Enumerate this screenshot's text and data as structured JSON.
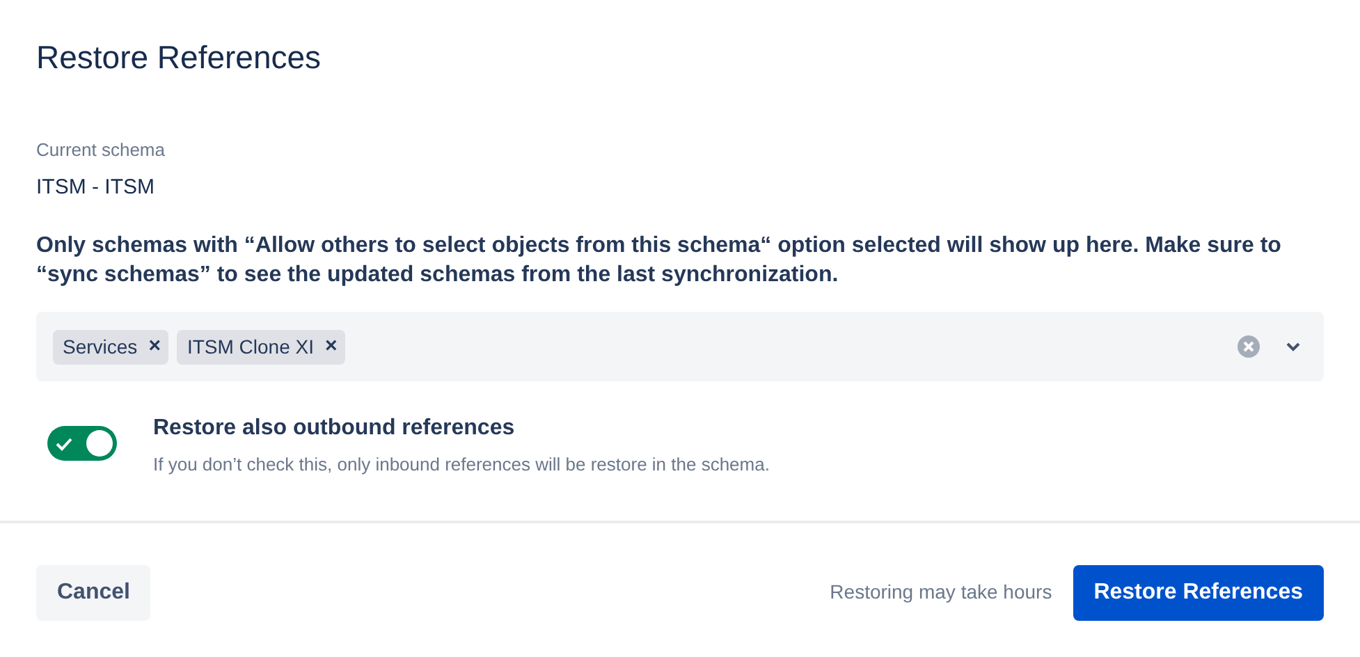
{
  "dialog": {
    "title": "Restore References"
  },
  "current_schema": {
    "label": "Current schema",
    "value": "ITSM - ITSM"
  },
  "notice": "Only schemas with “Allow others to select objects from this schema“ option selected will show up here. Make sure to “sync schemas” to see the updated schemas from the last synchronization.",
  "schema_select": {
    "tags": [
      {
        "label": "Services",
        "remove": "×"
      },
      {
        "label": "ITSM Clone XI",
        "remove": "×"
      }
    ]
  },
  "toggle": {
    "on": true,
    "label": "Restore also outbound references",
    "help": "If you don’t check this, only inbound references will be restore in the schema."
  },
  "footer": {
    "cancel": "Cancel",
    "hint": "Restoring may take hours",
    "submit": "Restore References"
  }
}
